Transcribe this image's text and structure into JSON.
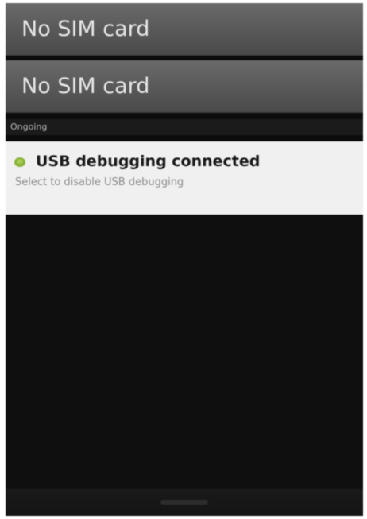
{
  "carriers": [
    {
      "label": "No SIM card"
    },
    {
      "label": "No SIM card"
    }
  ],
  "section_header": "Ongoing",
  "notification": {
    "icon": "android-usb-icon",
    "title": "USB debugging connected",
    "subtitle": "Select to disable USB debugging"
  },
  "colors": {
    "accent_icon": "#8ab33a",
    "notification_bg": "#f0f0f0",
    "shade_bg": "#0c0c0c"
  }
}
